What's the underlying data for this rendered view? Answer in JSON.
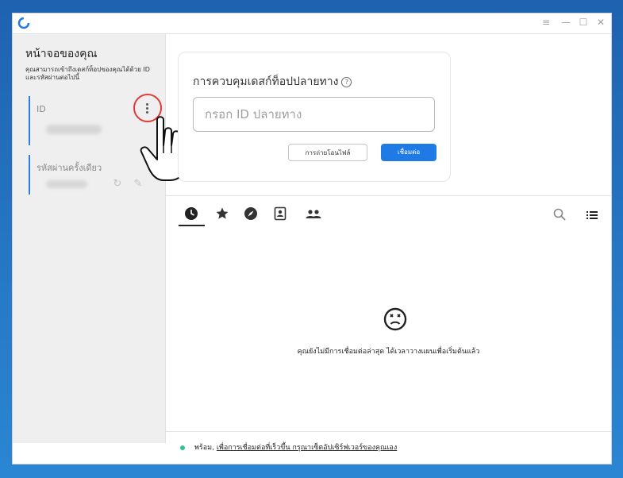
{
  "window": {
    "controls": [
      "≡",
      "—",
      "☐",
      "✕"
    ]
  },
  "sidebar": {
    "title": "หน้าจอของคุณ",
    "description": "คุณสามารถเข้าถึงเดสก์ท็อปของคุณได้ด้วย ID และรหัสผ่านต่อไปนี้",
    "id_label": "ID",
    "password_label": "รหัสผ่านครั้งเดียว"
  },
  "control_card": {
    "title": "การควบคุมเดสก์ท็อปปลายทาง",
    "input_placeholder": "กรอก ID ปลายทาง",
    "transfer_button": "การถ่ายโอนไฟล์",
    "connect_button": "เชื่อมต่อ"
  },
  "tabs": [
    {
      "icon": "clock-icon",
      "name": "recent"
    },
    {
      "icon": "star-icon",
      "name": "favorites"
    },
    {
      "icon": "compass-icon",
      "name": "discovered"
    },
    {
      "icon": "address-book-icon",
      "name": "address-book"
    },
    {
      "icon": "group-icon",
      "name": "group"
    }
  ],
  "empty_state": {
    "icon": "sad-face-icon",
    "message": "คุณยังไม่มีการเชื่อมต่อล่าสุด ได้เวลาวางแผนเพื่อเริ่มต้นแล้ว"
  },
  "status_bar": {
    "ready": "พร้อม,",
    "link": "เพื่อการเชื่อมต่อที่เร็วขึ้น กรุณาเซ็ตอัปเซิร์ฟเวอร์ของคุณเอง",
    "dot_color": "#2fc48d"
  },
  "colors": {
    "accent": "#1e7be6",
    "highlight_circle": "#e53935",
    "background": "#1e62b0"
  }
}
